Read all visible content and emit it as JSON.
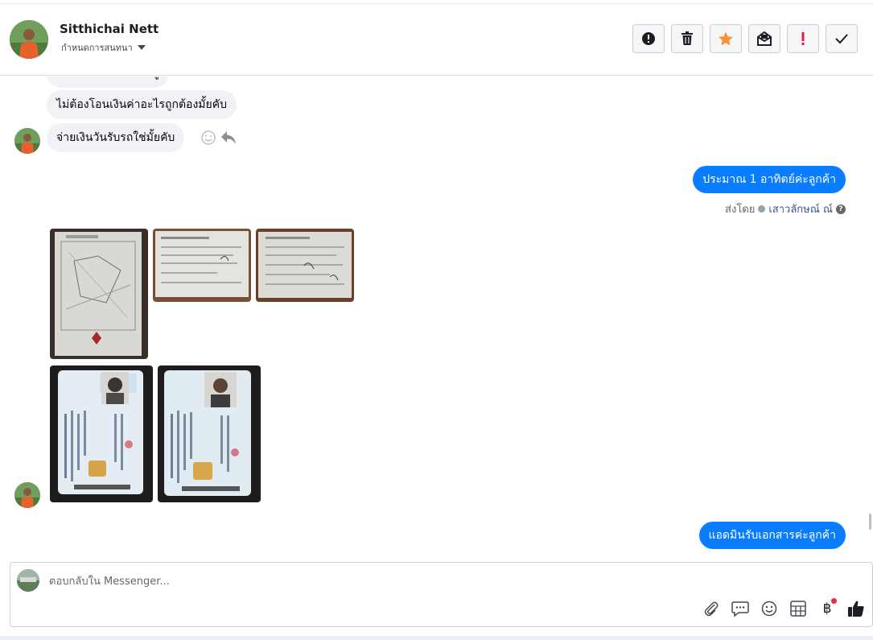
{
  "header": {
    "name": "Sitthichai Nett",
    "subtitle": "กำหนดการสนทนา",
    "actions": [
      {
        "icon": "alert-circle-icon",
        "color": "#1c1e21"
      },
      {
        "icon": "trash-icon",
        "color": "#1c1e21"
      },
      {
        "icon": "star-icon",
        "color": "#f7923b"
      },
      {
        "icon": "mark-unread-icon",
        "color": "#1c1e21"
      },
      {
        "icon": "exclamation-icon",
        "color": "#e41e3f"
      },
      {
        "icon": "checkmark-icon",
        "color": "#1c1e21"
      }
    ]
  },
  "messages": {
    "partial": "ใช่ไหมครับ ต้องการรู้",
    "msg1": "ไม่ต้องโอนเงินค่าอะไรถูกต้องมั้ยคับ",
    "msg2": "จ่ายเงินวันรับรถใช่มั้ยคับ",
    "out1": "ประมาณ 1 อาทิตย์ค่ะลูกค้า",
    "sent_by_prefix": "ส่งโดย",
    "sent_by_name": "เสาวลักษณ์ ณ์",
    "out2": "แอดมินรับเอกสารค่ะลูกค้า"
  },
  "attachments": {
    "row1": [
      "land-deed-photo",
      "document-photo-1",
      "document-photo-2"
    ],
    "row2": [
      "id-card-photo-1",
      "id-card-photo-2"
    ]
  },
  "composer": {
    "placeholder": "ตอบกลับใน Messenger...",
    "tools": [
      "paperclip-icon",
      "saved-reply-icon",
      "emoji-icon",
      "table-icon",
      "baht-icon",
      "like-icon"
    ],
    "baht_symbol": "฿"
  },
  "colors": {
    "accent": "#0a7cff",
    "incoming_bubble": "#f0f2f5",
    "star": "#f7923b",
    "alert_red": "#e41e3f"
  }
}
